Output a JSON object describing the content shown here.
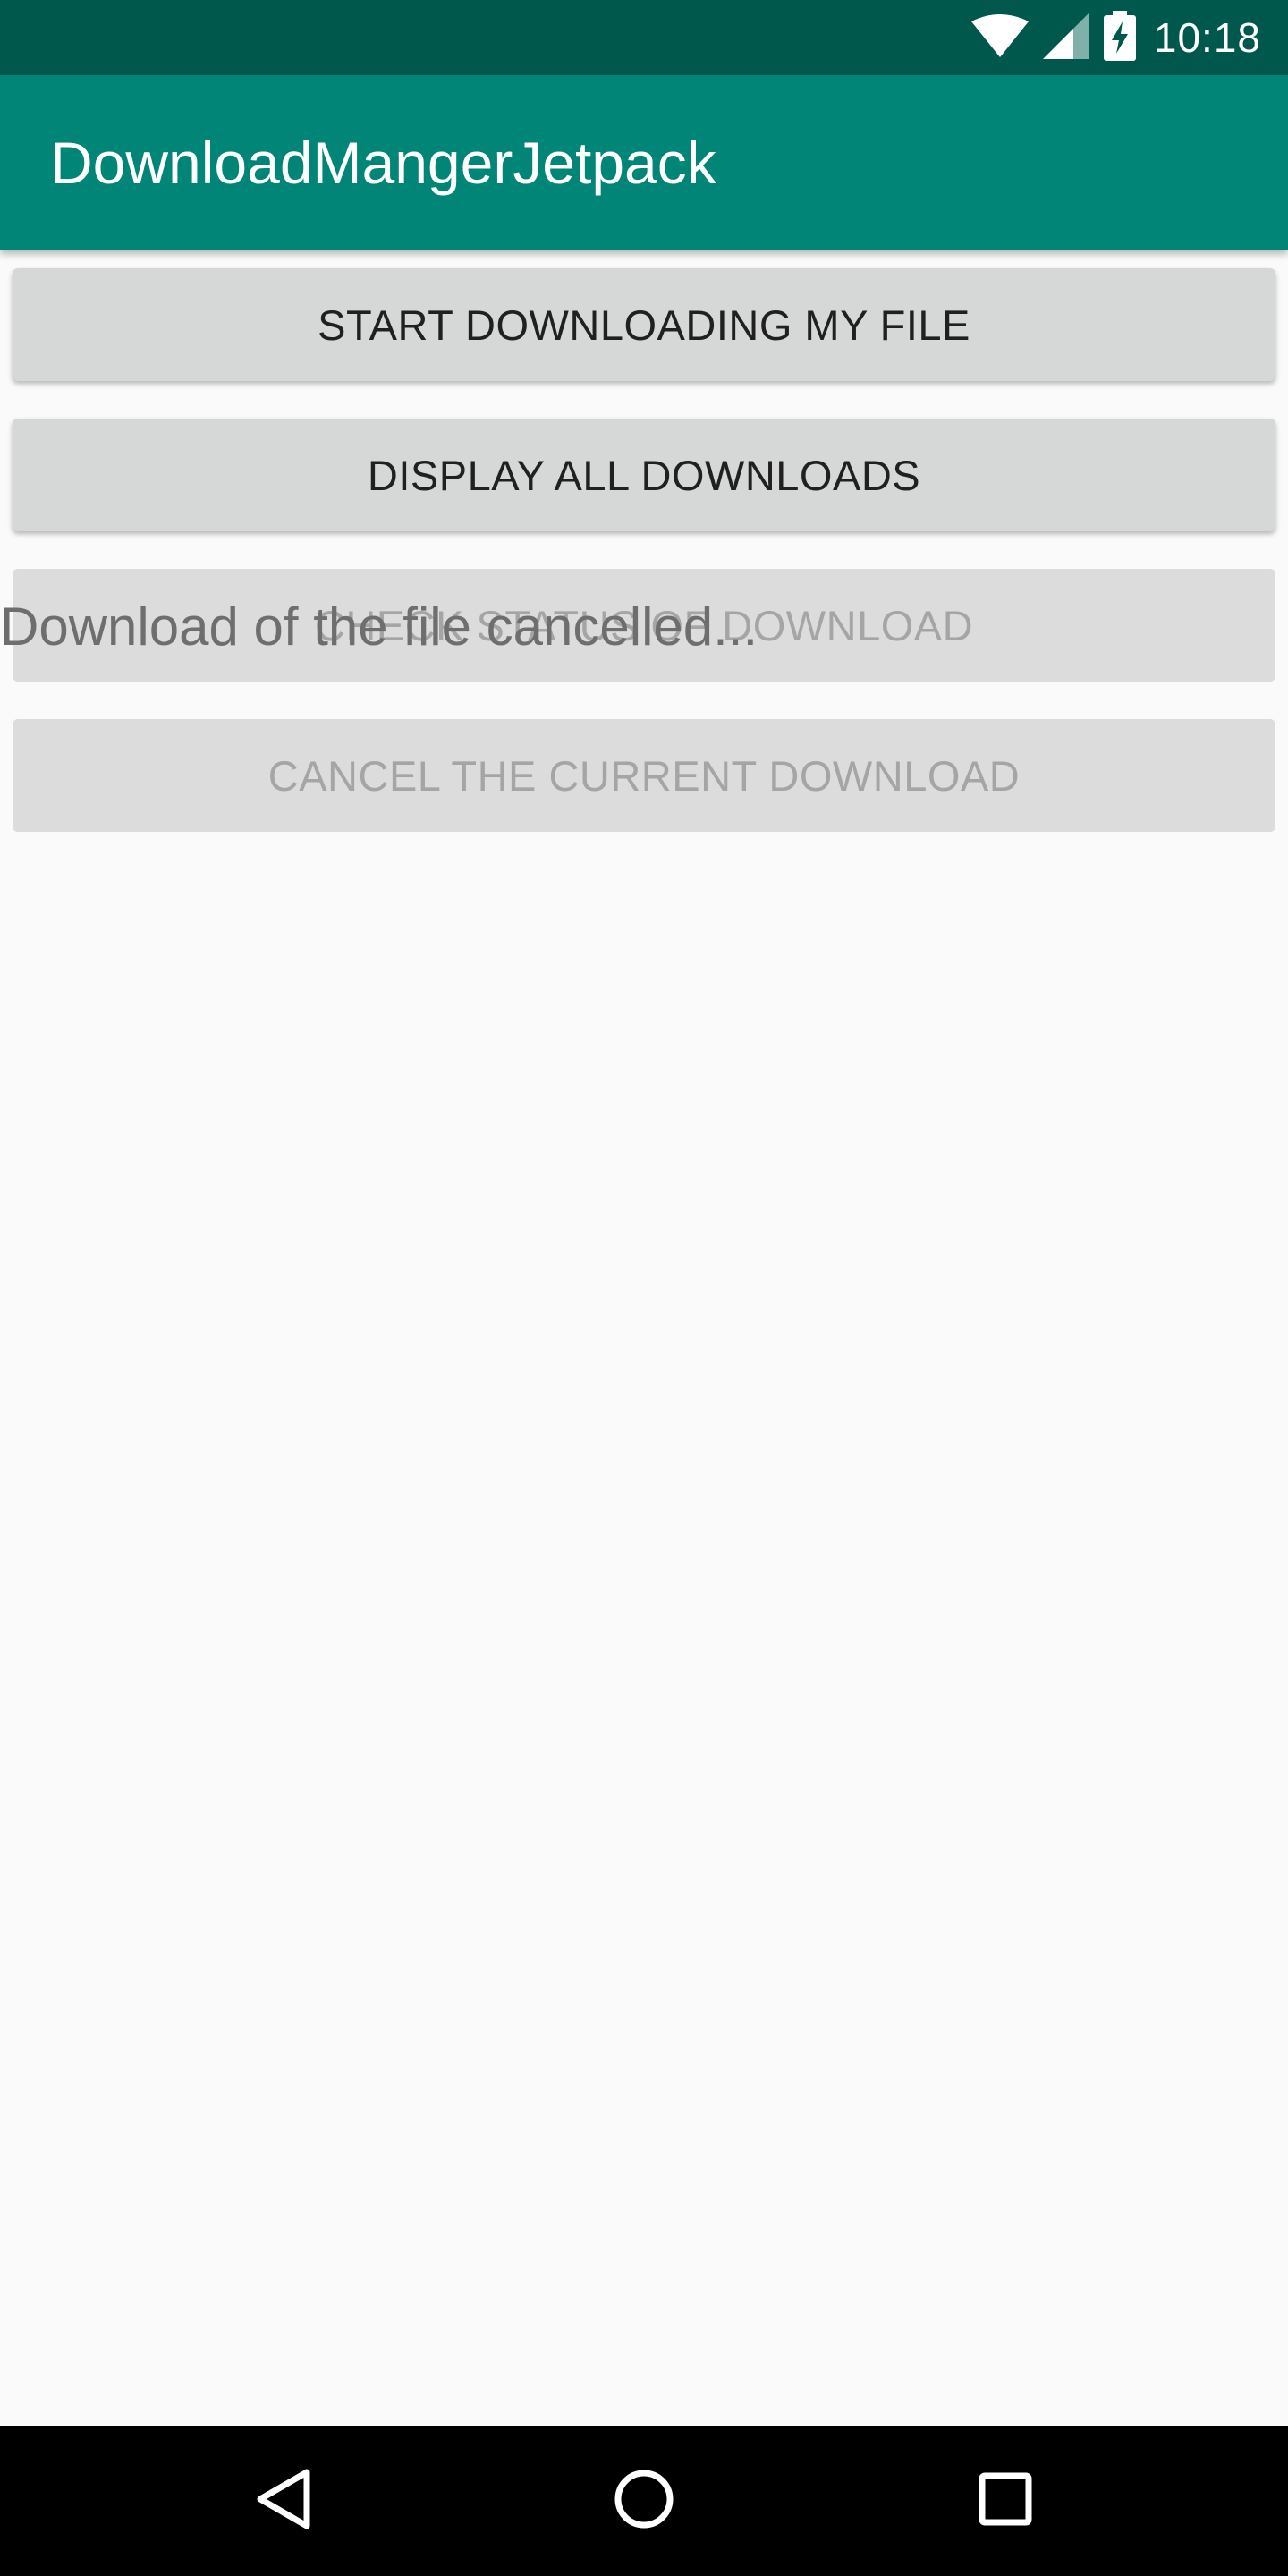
{
  "status_bar": {
    "time": "10:18",
    "icons": [
      "wifi-icon",
      "cell-signal-icon",
      "battery-charging-icon"
    ]
  },
  "app_bar": {
    "title": "DownloadMangerJetpack"
  },
  "buttons": {
    "start_download": {
      "label": "START DOWNLOADING MY FILE",
      "enabled": true
    },
    "display_downloads": {
      "label": "DISPLAY ALL DOWNLOADS",
      "enabled": true
    },
    "check_status": {
      "label": "CHECK STATUS OF DOWNLOAD",
      "enabled": false
    },
    "cancel_download": {
      "label": "CANCEL THE CURRENT DOWNLOAD",
      "enabled": false
    }
  },
  "status_message": "Download of the file cancelled...",
  "nav_bar": {
    "icons": [
      "back-icon",
      "home-icon",
      "recents-icon"
    ]
  },
  "colors": {
    "status_bar": "#00574b",
    "app_bar": "#008577",
    "background": "#fafafa",
    "button": "#d6d7d7",
    "button_text": "#202020",
    "button_disabled_text": "#a5a5a5",
    "status_text": "#6e6e6e"
  }
}
